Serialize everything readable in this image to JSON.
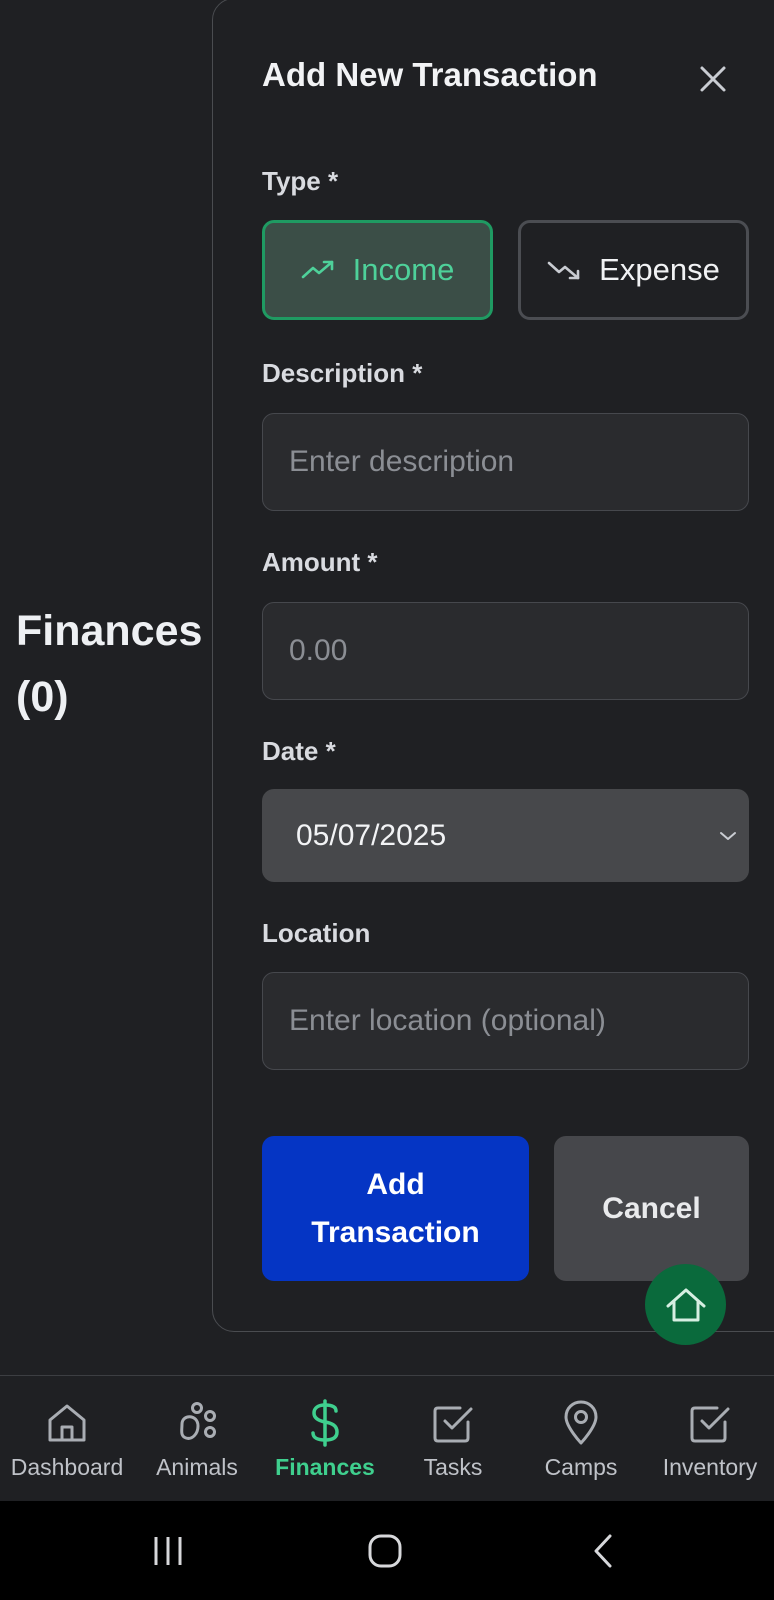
{
  "background_page": {
    "title": "Finances\n(0)"
  },
  "dialog": {
    "title": "Add New Transaction",
    "close_icon": "close-icon",
    "type": {
      "label": "Type *",
      "options": [
        {
          "label": "Income",
          "icon": "trending-up-icon",
          "selected": true
        },
        {
          "label": "Expense",
          "icon": "trending-down-icon",
          "selected": false
        }
      ]
    },
    "description": {
      "label": "Description *",
      "value": "",
      "placeholder": "Enter description"
    },
    "amount": {
      "label": "Amount *",
      "value": "",
      "placeholder": "0.00"
    },
    "date": {
      "label": "Date *",
      "value": "05/07/2025"
    },
    "location": {
      "label": "Location",
      "value": "",
      "placeholder": "Enter location (optional)"
    },
    "submit_label": "Add\nTransaction",
    "cancel_label": "Cancel"
  },
  "fab": {
    "icon": "home-icon"
  },
  "bottom_nav": {
    "items": [
      {
        "label": "Dashboard",
        "icon": "home-icon",
        "active": false
      },
      {
        "label": "Animals",
        "icon": "paw-icon",
        "active": false
      },
      {
        "label": "Finances",
        "icon": "dollar-icon",
        "active": true
      },
      {
        "label": "Tasks",
        "icon": "checkbox-icon",
        "active": false
      },
      {
        "label": "Camps",
        "icon": "map-pin-icon",
        "active": false
      },
      {
        "label": "Inventory",
        "icon": "checkbox-icon",
        "active": false
      }
    ]
  },
  "system_nav": {
    "buttons": [
      "recents-icon",
      "home-circle-icon",
      "back-icon"
    ]
  },
  "colors": {
    "accent_green": "#3fcf8e",
    "primary_blue": "#0535c4",
    "background": "#1f2023"
  }
}
